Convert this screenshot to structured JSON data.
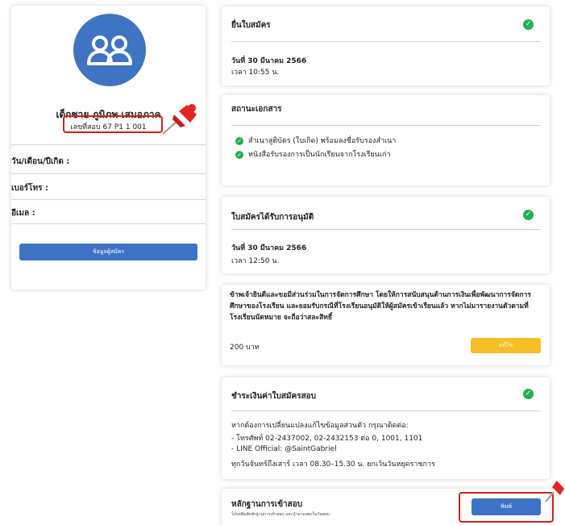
{
  "profile": {
    "name": "เด็กชาย ภูมิภพ เสมอภาค",
    "exam_id": "เลขที่สอบ 67 P1 1 001",
    "fields": [
      {
        "label": "วัน/เดือน/ปีเกิด :"
      },
      {
        "label": "เบอร์โทร :"
      },
      {
        "label": "อีเมล :"
      }
    ],
    "applicant_button": "ข้อมูลผู้สมัคร"
  },
  "submitted": {
    "title": "ยื่นใบสมัคร",
    "date": "วันที่ 30 มีนาคม 2566",
    "time": "เวลา 10:55 น."
  },
  "documents": {
    "title": "สถานะเอกสาร",
    "items": [
      "สำเนาสูติบัตร (ใบเกิด) พร้อมลงชื่อรับรองสำเนา",
      "หนังสือรับรองการเป็นนักเรียนจากโรงเรียนเก่า"
    ]
  },
  "approved": {
    "title": "ใบสมัครได้รับการอนุมัติ",
    "date": "วันที่ 30 มีนาคม 2566",
    "time": "เวลา 12:50 น."
  },
  "donation": {
    "text": "ข้าพเจ้ายินดีและขอมีส่วนร่วมในการจัดการศึกษา โดยให้การสนับสนุนด้านการเงินเพื่อพัฒนาการจัดการศึกษาของโรงเรียน และยอมรับกรณีที่โรงเรียนอนุมัติให้ผู้สมัครเข้าเรียนแล้ว หากไม่มารายงานตัวตามที่โรงเรียนนัดหมาย จะถือว่าสละสิทธิ์",
    "amount": "200 บาท",
    "edit_button": "แก้ไข"
  },
  "payment": {
    "title": "ชำระเงินค่าใบสมัครสอบ",
    "lines": [
      "หากต้องการเปลี่ยนแปลงแก้ไขข้อมูลส่วนตัว กรุณาติดต่อ:",
      "- โทรศัพท์ 02-2437002, 02-2432153 ต่อ 0, 1001, 1101",
      "- LINE Official: @SaintGabriel",
      "ทุกวันจันทร์ถึงเสาร์ เวลา 08.30–15.30 น. ยกเว้นวันหยุดราชการ"
    ]
  },
  "exam_card": {
    "title": "หลักฐานการเข้าสอบ",
    "subtitle": "โปรดพิมพ์หลักฐานการเข้าสอบ และนำมาแสดงในวันสอบ",
    "print_button": "พิมพ์"
  },
  "colors": {
    "accent_blue": "#3d72c4",
    "check_green": "#27ae4f",
    "edit_yellow": "#f6bf26",
    "highlight_red": "#d0201b"
  },
  "icons": [
    "users-icon",
    "check-circle-icon",
    "pushpin-icon"
  ]
}
